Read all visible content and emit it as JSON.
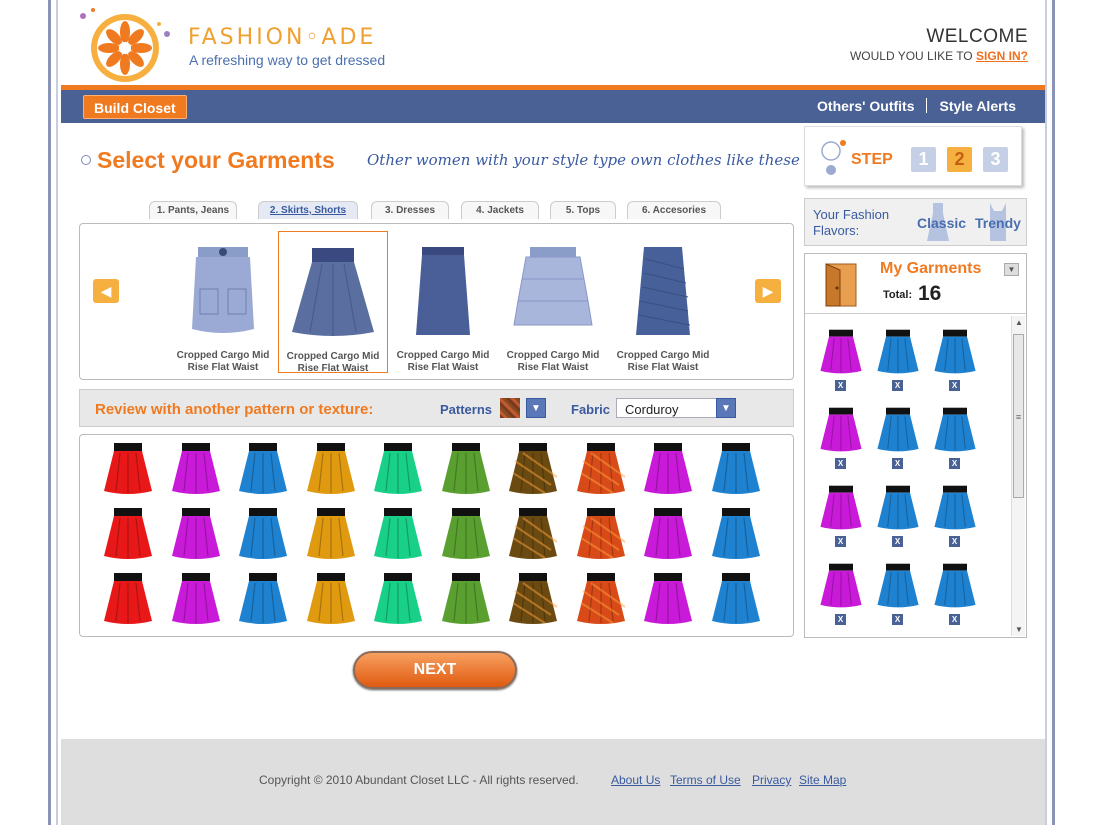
{
  "brand": {
    "name": "FASHION◦ADE",
    "tagline": "A refreshing way to get dressed"
  },
  "header": {
    "welcome": "WELCOME",
    "prompt": "WOULD YOU LIKE TO",
    "signin": "SIGN IN?"
  },
  "nav": {
    "build_closet": "Build Closet",
    "others_outfits": "Others' Outfits",
    "style_alerts": "Style Alerts"
  },
  "select": {
    "title": "Select your Garments",
    "subtitle": "Other women with your style type own clothes like these",
    "tabs": [
      "1. Pants, Jeans",
      "2. Skirts, Shorts",
      "3. Dresses",
      "4. Jackets",
      "5. Tops",
      "6. Accesories"
    ],
    "active_tab": 1
  },
  "carousel": {
    "items": [
      {
        "label": "Cropped Cargo Mid Rise Flat Waist",
        "style": "cargo"
      },
      {
        "label": "Cropped Cargo Mid Rise Flat Waist",
        "style": "flared"
      },
      {
        "label": "Cropped Cargo Mid Rise Flat Waist",
        "style": "pencil"
      },
      {
        "label": "Cropped Cargo Mid Rise Flat Waist",
        "style": "ruffled"
      },
      {
        "label": "Cropped Cargo Mid Rise Flat Waist",
        "style": "ruched"
      }
    ],
    "selected_index": 1
  },
  "pattern": {
    "title": "Review with another pattern or texture:",
    "patterns_label": "Patterns",
    "fabric_label": "Fabric",
    "fabric_value": "Corduroy"
  },
  "swatch_colors": [
    "#e81818",
    "#c81ad8",
    "#1e82d0",
    "#e09a10",
    "#18d088",
    "#5aa030",
    "#6a4a10",
    "#d84a18",
    "#c81ad8",
    "#1e82d0"
  ],
  "next_label": "NEXT",
  "step": {
    "label": "STEP",
    "numbers": [
      "1",
      "2",
      "3"
    ],
    "current": 2
  },
  "flavors": {
    "label": "Your Fashion Flavors:",
    "items": [
      "Classic",
      "Trendy"
    ]
  },
  "closet": {
    "title": "My Garments",
    "total_label": "Total:",
    "total_value": "16",
    "rows": [
      [
        "#c81ad8",
        "#1e82d0",
        "#1e82d0"
      ],
      [
        "#c81ad8",
        "#1e82d0",
        "#1e82d0"
      ],
      [
        "#c81ad8",
        "#1e82d0",
        "#1e82d0"
      ],
      [
        "#c81ad8",
        "#1e82d0",
        "#1e82d0"
      ]
    ],
    "remove_label": "X",
    "scroll_grip": "≡"
  },
  "footer": {
    "copyright": "Copyright © 2010 Abundant Closet LLC - All rights reserved.",
    "links": [
      "About Us",
      "Terms of Use",
      "Privacy",
      "Site Map"
    ]
  },
  "icons": [
    "logo-sun-icon",
    "door-icon",
    "dress-icon",
    "arrow-left-icon",
    "arrow-right-icon",
    "chevron-down-icon"
  ]
}
